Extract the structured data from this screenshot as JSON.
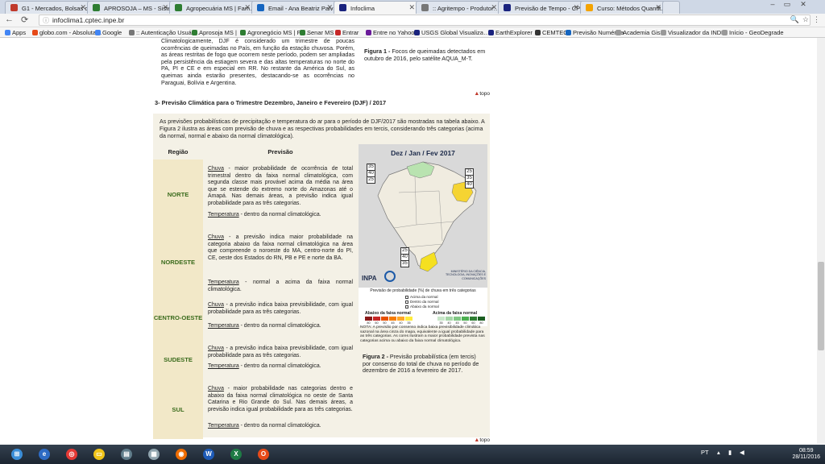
{
  "browser": {
    "tabs": [
      {
        "label": "G1 - Mercados, Bolsas d…",
        "color": "#c0392b"
      },
      {
        "label": "APROSOJA – MS - Sister…",
        "color": "#2e7d32"
      },
      {
        "label": "Agropecuária MS | Fam…",
        "color": "#2e7d32"
      },
      {
        "label": "Email - Ana Beatriz Paiv…",
        "color": "#1565c0"
      },
      {
        "label": "Infoclima",
        "color": "#1a237e"
      },
      {
        "label": ":: Agritempo - Produtor…",
        "color": "#777777"
      },
      {
        "label": "Previsão de Tempo - CP…",
        "color": "#1a237e"
      },
      {
        "label": "Curso: Métodos Quantit…",
        "color": "#f4a300"
      }
    ],
    "url": "infoclima1.cptec.inpe.br",
    "bookmarks": [
      {
        "label": "Apps",
        "color": "#4285f4"
      },
      {
        "label": "globo.com - Absoluta…",
        "color": "#e64a19"
      },
      {
        "label": "Google",
        "color": "#4285f4"
      },
      {
        "label": ":: Autenticação Usuár…",
        "color": "#777777"
      },
      {
        "label": "Aprosoja MS |",
        "color": "#2e7d32"
      },
      {
        "label": "Agronegócio MS | Fa…",
        "color": "#2e7d32"
      },
      {
        "label": "Senar MS",
        "color": "#2e7d32"
      },
      {
        "label": "Entrar",
        "color": "#c62828"
      },
      {
        "label": "Entre no Yahoo",
        "color": "#6a1b9a"
      },
      {
        "label": "USGS Global Visualiza…",
        "color": "#1a237e"
      },
      {
        "label": "EarthExplorer",
        "color": "#1a237e"
      },
      {
        "label": "CEMTEC",
        "color": "#333333"
      },
      {
        "label": "Previsão Numérica",
        "color": "#1565c0"
      },
      {
        "label": "Academia Gis",
        "color": "#999999"
      },
      {
        "label": "Visualizador da INDE",
        "color": "#999999"
      },
      {
        "label": "Início - GeoDegrade",
        "color": "#999999"
      }
    ]
  },
  "page": {
    "top_paragraph": "Climatologicamente, DJF é considerado um trimestre de poucas ocorrências de queimadas no País, em função da estação chuvosa. Porém, as áreas restritas de fogo que ocorrem neste período, podem ser ampliadas pela persistência da estiagem severa e das altas temperaturas no norte do PA, PI e CE e em especial em RR. No restante da América do Sul, as queimas ainda estarão presentes, destacando-se as ocorrências no Paraguai, Bolívia e Argentina.",
    "fig1_caption_bold": "Figura 1 -",
    "fig1_caption": " Focos de queimadas detectados em outubro de 2016, pelo satélite AQUA_M-T.",
    "top_link": "topo",
    "section_title": "3- Previsão Climática para o Trimestre Dezembro, Janeiro e Fevereiro (DJF)  / 2017",
    "intro": "As previsões probabilísticas de precipitação e temperatura do ar para o período de DJF/2017 são mostradas na tabela abaixo. A Figura 2 ilustra as áreas com previsão de chuva e as respectivas probabilidades em tercis, considerando três categorias (acima da normal, normal e abaixo da normal climatológica).",
    "table": {
      "col_region": "Região",
      "col_forecast": "Previsão",
      "rows": [
        {
          "region": "NORTE",
          "rain_label": "Chuva",
          "rain": " - maior probabilidade de ocorrência de total trimestral dentro da faixa normal climatológica, com segunda classe mais provável acima da média na área que se estende do extremo norte do Amazonas até o Amapá. Nas demais áreas, a previsão indica igual probabilidade para as três categorias.",
          "temp_label": "Temperatura",
          "temp": " - dentro da normal climatológica."
        },
        {
          "region": "NORDESTE",
          "rain_label": "Chuva",
          "rain": " - a previsão indica maior probabilidade na categoria abaixo da faixa normal climatológica na área que compreende o noroeste do MA, centro-norte do PI, CE, oeste dos Estados do RN, PB e PE e norte da BA.",
          "temp_label": "Temperatura",
          "temp": " - normal a acima da faixa normal climatológica."
        },
        {
          "region": "CENTRO-OESTE",
          "rain_label": "Chuva",
          "rain": " - a previsão indica baixa previsibilidade, com igual probabilidade para as três categorias.",
          "temp_label": "Temperatura",
          "temp": " - dentro da normal climatológica."
        },
        {
          "region": "SUDESTE",
          "rain_label": "Chuva",
          "rain": " - a previsão indica baixa previsibilidade, com igual probabilidade para as três categorias.",
          "temp_label": "Temperatura",
          "temp": " - dentro da normal climatológica."
        },
        {
          "region": "SUL",
          "rain_label": "Chuva",
          "rain": " - maior probabilidade nas categorias dentro e abaixo da faixa normal climatológica no oeste de Santa Catarina e Rio Grande do Sul. Nas demais áreas, a previsão indica igual probabilidade para as três categorias.",
          "temp_label": "Temperatura",
          "temp": " - dentro da normal climatológica."
        }
      ]
    },
    "map": {
      "title": "Dez / Jan / Fev 2017",
      "box_north": [
        "35",
        "40",
        "25"
      ],
      "box_northeast": [
        "25",
        "35",
        "40"
      ],
      "box_south": [
        "25",
        "40",
        "35"
      ],
      "inpa": "INPA",
      "ministry": "MINISTÉRIO DA CIÊNCIA, TECNOLOGIA, INOVAÇÕES E COMUNICAÇÕES",
      "legend_title": "Previsão de probabilidade (%) de chuva em três categorias",
      "legend_options": [
        "Acima da normal",
        "Dentro da normal",
        "Abaixo da normal"
      ],
      "legend_below": "Abaixo da faixa normal",
      "legend_above": "Acima da faixa normal",
      "scale": [
        "80",
        "60",
        "50",
        "45",
        "40",
        "35",
        "35",
        "40",
        "45",
        "50",
        "60",
        "80"
      ],
      "nota": "NOTA: A previsão por consenso indica baixa previsibilidade climática sazonal na área cinza do mapa, equivalente a igual probabilidade para as três categorias. As cores ilustram a maior probabilidade prevista nas categorias acima ou abaixo da faixa normal climatológica."
    },
    "fig2_bold": "Figura 2 -",
    "fig2_caption": " Previsão probabilística (em tercis) por consenso do total de chuva no período de dezembro de 2016 a fevereiro de 2017."
  },
  "taskbar": {
    "apps": [
      "start",
      "ie",
      "chrome",
      "explorer",
      "files",
      "calc",
      "firefox",
      "word",
      "excel",
      "office"
    ],
    "lang": "PT",
    "time": "08:59",
    "date": "28/11/2016"
  }
}
